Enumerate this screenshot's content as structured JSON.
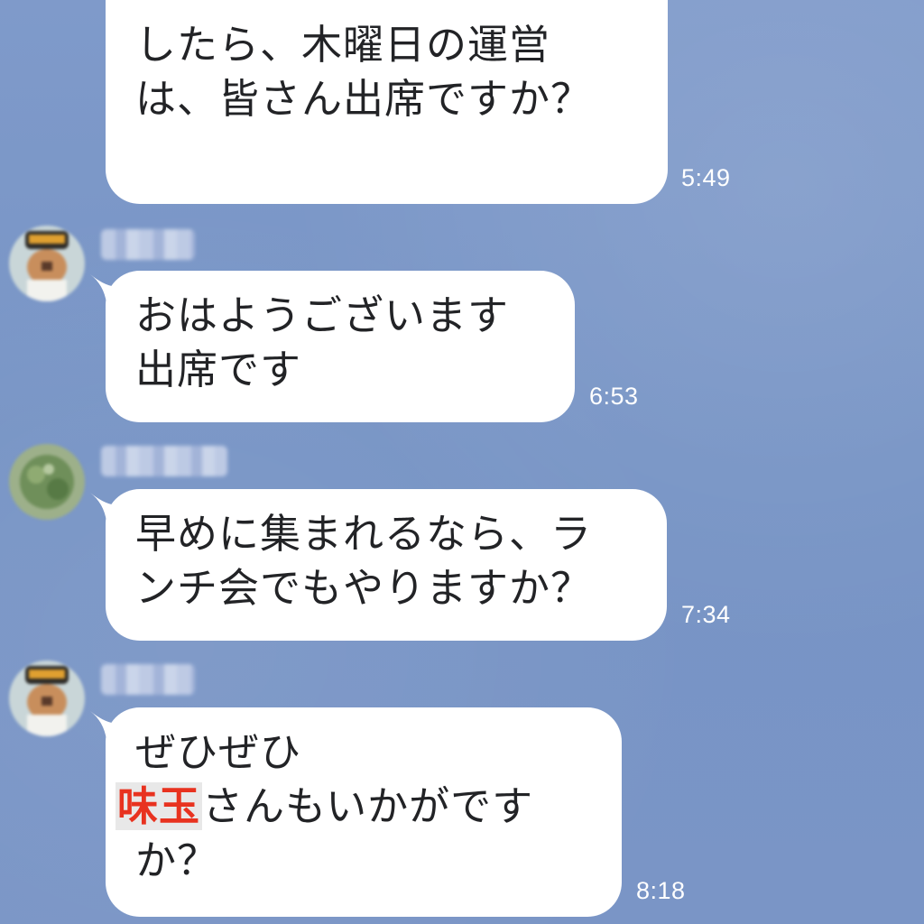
{
  "chat": {
    "messages": [
      {
        "lines": [
          "したら、木曜日の運営",
          "は、皆さん出席ですか？"
        ],
        "time": "5:49"
      },
      {
        "lines": [
          "おはようございます",
          "出席です"
        ],
        "time": "6:53"
      },
      {
        "lines": [
          "早めに集まれるなら、ラ",
          "ンチ会でもやりますか？"
        ],
        "time": "7:34"
      },
      {
        "line1": "ぜひぜひ",
        "highlight": "味玉",
        "line2_rest": "さんもいかがです",
        "line3": "か？",
        "time": "8:18"
      }
    ]
  },
  "colors": {
    "background": "#7b96c6",
    "bubble": "#ffffff",
    "text": "#222326",
    "highlight": "#e8321f",
    "timestamp": "#ffffff"
  },
  "icons": {
    "avatar_1": "avatar-icon",
    "avatar_2": "avatar-icon",
    "avatar_3": "avatar-icon"
  }
}
